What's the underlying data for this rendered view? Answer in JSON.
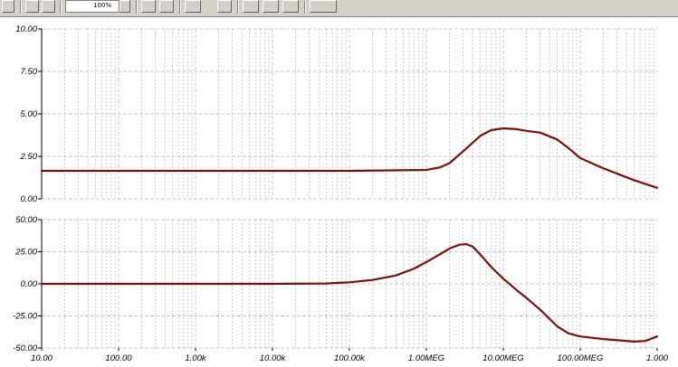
{
  "toolbar": {
    "zoom_label": "100%"
  },
  "colors": {
    "trace": "#7b0f0f",
    "grid": "#b4b4b4",
    "axis": "#000000",
    "toolbar_bg": "#d4d0c8"
  },
  "chart_data": [
    {
      "type": "line",
      "x_scale": "log",
      "xlim": [
        10,
        1000000000
      ],
      "ylim": [
        0,
        10
      ],
      "yticks": [
        "10.00",
        "7.50",
        "5.00",
        "2.50",
        "0.00"
      ],
      "ytick_values": [
        10,
        7.5,
        5,
        2.5,
        0
      ],
      "grid": true,
      "series": [
        {
          "x": [
            10,
            100,
            1000,
            10000,
            100000,
            1000000,
            1500000,
            2000000,
            3000000,
            5000000,
            7000000,
            10000000,
            15000000,
            20000000,
            30000000,
            50000000,
            70000000,
            100000000,
            200000000,
            500000000,
            1000000000
          ],
          "y": [
            1.65,
            1.65,
            1.65,
            1.65,
            1.65,
            1.7,
            1.85,
            2.1,
            2.8,
            3.7,
            4.05,
            4.15,
            4.1,
            4.0,
            3.9,
            3.5,
            3.0,
            2.4,
            1.8,
            1.1,
            0.65
          ]
        }
      ]
    },
    {
      "type": "line",
      "x_scale": "log",
      "xlim": [
        10,
        1000000000
      ],
      "ylim": [
        -50,
        50
      ],
      "yticks": [
        "50.00",
        "25.00",
        "0.00",
        "-25.00",
        "-50.00"
      ],
      "ytick_values": [
        50,
        25,
        0,
        -25,
        -50
      ],
      "xtick_labels": [
        "10.00",
        "100.00",
        "1.00k",
        "10.00k",
        "100.00k",
        "1.00MEG",
        "10.00MEG",
        "100.00MEG",
        "1.000"
      ],
      "xtick_values": [
        10,
        100,
        1000,
        10000,
        100000,
        1000000,
        10000000,
        100000000,
        1000000000
      ],
      "grid": true,
      "series": [
        {
          "x": [
            10,
            1000,
            10000,
            50000,
            100000,
            200000,
            400000,
            700000,
            1000000,
            1500000,
            2000000,
            2700000,
            3300000,
            4000000,
            5000000,
            7000000,
            10000000,
            15000000,
            20000000,
            30000000,
            50000000,
            70000000,
            100000000,
            200000000,
            500000000,
            700000000,
            1000000000
          ],
          "y": [
            0,
            0,
            0,
            0.3,
            1.2,
            3,
            6.5,
            12,
            17,
            23,
            27.5,
            30.5,
            31,
            29,
            23,
            13,
            4,
            -5,
            -11,
            -20,
            -33,
            -38.5,
            -41,
            -43,
            -45,
            -44.5,
            -41
          ]
        }
      ]
    }
  ]
}
